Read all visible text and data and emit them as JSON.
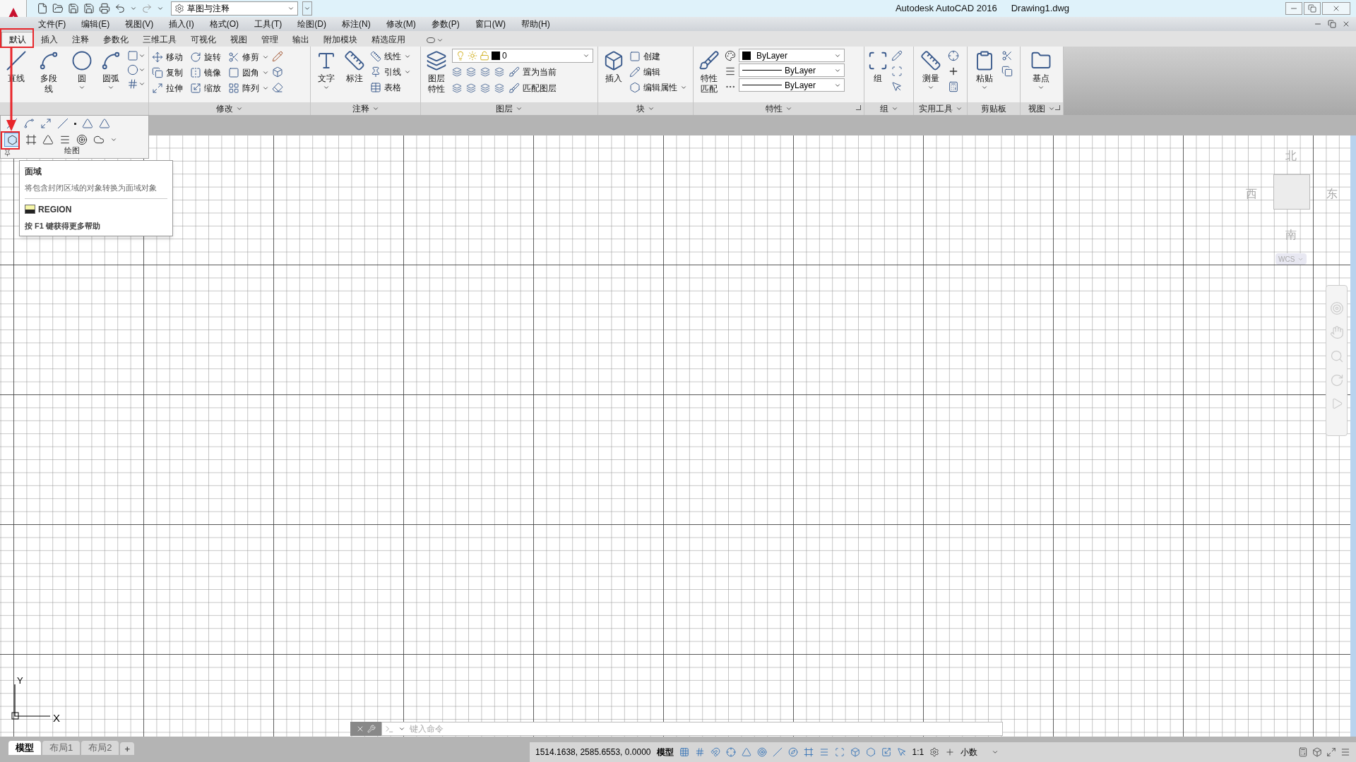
{
  "window": {
    "title": "Autodesk AutoCAD 2016",
    "document": "Drawing1.dwg"
  },
  "quick_access": {
    "workspace": "草图与注释"
  },
  "menu": [
    "文件(F)",
    "编辑(E)",
    "视图(V)",
    "插入(I)",
    "格式(O)",
    "工具(T)",
    "绘图(D)",
    "标注(N)",
    "修改(M)",
    "参数(P)",
    "窗口(W)",
    "帮助(H)"
  ],
  "ribbon_tabs": [
    {
      "label": "默认",
      "selected": true
    },
    {
      "label": "插入",
      "selected": false
    },
    {
      "label": "注释",
      "selected": false
    },
    {
      "label": "参数化",
      "selected": false
    },
    {
      "label": "三维工具",
      "selected": false
    },
    {
      "label": "可视化",
      "selected": false
    },
    {
      "label": "视图",
      "selected": false
    },
    {
      "label": "管理",
      "selected": false
    },
    {
      "label": "输出",
      "selected": false
    },
    {
      "label": "附加模块",
      "selected": false
    },
    {
      "label": "精选应用",
      "selected": false
    }
  ],
  "draw_panel": {
    "title": "绘图",
    "tools": [
      {
        "label": "直线",
        "dropdown": false
      },
      {
        "label": "多段线",
        "dropdown": false
      },
      {
        "label": "圆",
        "dropdown": true
      },
      {
        "label": "圆弧",
        "dropdown": true
      }
    ]
  },
  "modify_panel": {
    "title": "修改",
    "title_dropdown": true,
    "tools": [
      {
        "label": "移动",
        "dropdown": false
      },
      {
        "label": "旋转",
        "dropdown": false
      },
      {
        "label": "修剪",
        "dropdown": true
      },
      {
        "label": "复制",
        "dropdown": false
      },
      {
        "label": "镜像",
        "dropdown": false
      },
      {
        "label": "圆角",
        "dropdown": true
      },
      {
        "label": "拉伸",
        "dropdown": false
      },
      {
        "label": "缩放",
        "dropdown": false
      },
      {
        "label": "阵列",
        "dropdown": true
      }
    ]
  },
  "annotation_panel": {
    "title": "注释",
    "title_dropdown": true,
    "big_tools": [
      {
        "label": "文字",
        "dropdown": true
      },
      {
        "label": "标注",
        "dropdown": false
      }
    ],
    "tools": [
      {
        "label": "线性",
        "dropdown": true
      },
      {
        "label": "引线",
        "dropdown": true
      },
      {
        "label": "表格",
        "dropdown": false
      }
    ]
  },
  "layers_panel": {
    "title": "图层",
    "title_dropdown": true,
    "button": "图层特性",
    "current_layer": "0",
    "tools": [
      {
        "label": "置为当前"
      },
      {
        "label": "匹配图层"
      }
    ]
  },
  "block_panel": {
    "title": "块",
    "title_dropdown": true,
    "button": "插入",
    "tools": [
      {
        "label": "创建",
        "dropdown": false
      },
      {
        "label": "编辑",
        "dropdown": false
      },
      {
        "label": "编辑属性",
        "dropdown": true
      }
    ]
  },
  "properties_panel": {
    "title": "特性",
    "title_dropdown": true,
    "launcher": true,
    "button": "特性匹配",
    "color_setting": "ByLayer",
    "linetype": "ByLayer",
    "lineweight": "ByLayer"
  },
  "group_panel": {
    "title": "组",
    "title_dropdown": true,
    "button": {
      "label": "组",
      "dropdown": false
    }
  },
  "utilities_panel": {
    "title": "实用工具",
    "title_dropdown": true,
    "button": {
      "label": "测量",
      "dropdown": true
    }
  },
  "clipboard_panel": {
    "title": "剪贴板",
    "title_dropdown": false,
    "button": {
      "label": "粘贴",
      "dropdown": true
    }
  },
  "view_panel": {
    "title": "视图",
    "title_dropdown": true,
    "launcher": true,
    "button": {
      "label": "基点",
      "dropdown": true
    }
  },
  "tooltip": {
    "title": "面域",
    "description": "将包含封闭区域的对象转换为面域对象",
    "command": "REGION",
    "help": "按 F1 键获得更多帮助"
  },
  "viewcube": {
    "north": "北",
    "south": "南",
    "east": "东",
    "west": "西",
    "ucs": "WCS"
  },
  "ucs_icon": {
    "x_label": "X",
    "y_label": "Y"
  },
  "command_line": {
    "placeholder": "键入命令"
  },
  "layout_tabs": [
    {
      "label": "模型",
      "selected": true
    },
    {
      "label": "布局1",
      "selected": false
    },
    {
      "label": "布局2",
      "selected": false
    }
  ],
  "add_layout": "+",
  "status_bar": {
    "coordinates": "1514.1638, 2585.6553, 0.0000",
    "space": "模型",
    "scale": "1:1",
    "units": "小数"
  }
}
